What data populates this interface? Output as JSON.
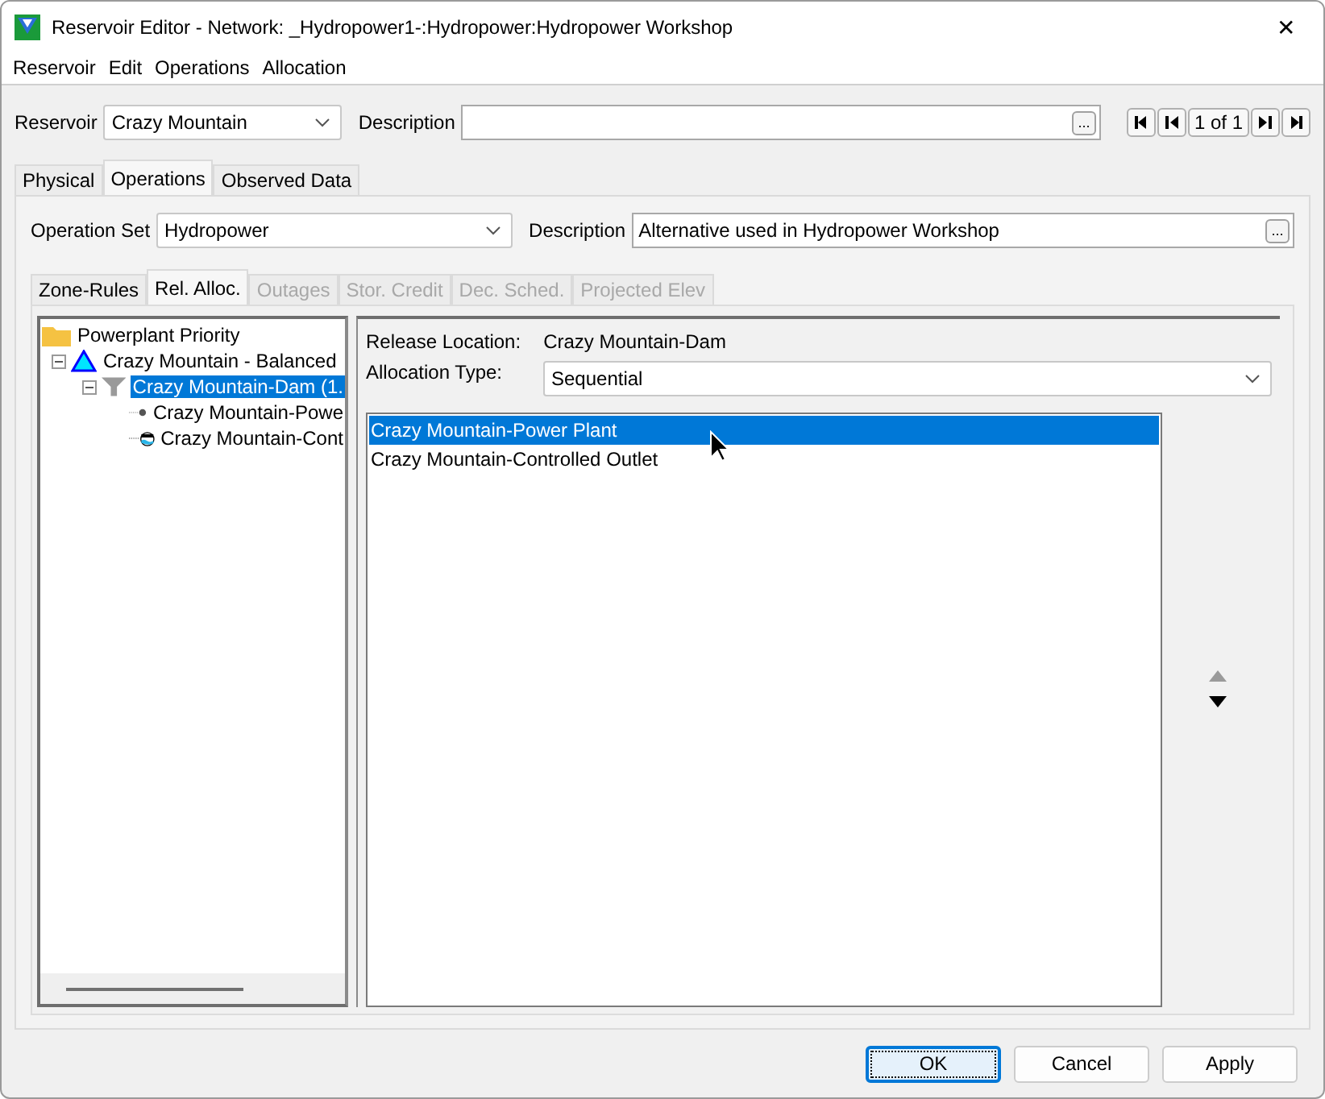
{
  "window": {
    "title": "Reservoir Editor - Network: _Hydropower1-:Hydropower:Hydropower Workshop",
    "close": "✕"
  },
  "menu": [
    "Reservoir",
    "Edit",
    "Operations",
    "Allocation"
  ],
  "reservoir": {
    "label": "Reservoir",
    "value": "Crazy Mountain"
  },
  "description": {
    "label": "Description",
    "browse": "..."
  },
  "record_nav": {
    "position": "1 of 1"
  },
  "tabs": [
    {
      "label": "Physical",
      "selected": false
    },
    {
      "label": "Operations",
      "selected": true
    },
    {
      "label": "Observed Data",
      "selected": false
    }
  ],
  "operation_set": {
    "label": "Operation Set",
    "value": "Hydropower"
  },
  "set_description": {
    "label": "Description",
    "value": "Alternative used in Hydropower Workshop",
    "browse": "..."
  },
  "subtabs": [
    {
      "label": "Zone-Rules",
      "selected": false,
      "disabled": false
    },
    {
      "label": "Rel. Alloc.",
      "selected": true,
      "disabled": false
    },
    {
      "label": "Outages",
      "selected": false,
      "disabled": true
    },
    {
      "label": "Stor. Credit",
      "selected": false,
      "disabled": true
    },
    {
      "label": "Dec. Sched.",
      "selected": false,
      "disabled": true
    },
    {
      "label": "Projected Elev",
      "selected": false,
      "disabled": true
    }
  ],
  "tree": [
    {
      "label": "Powerplant Priority",
      "kind": "folder",
      "selected": false,
      "children": [
        {
          "label": "Crazy Mountain - Balanced",
          "kind": "reservoir",
          "expanded": true,
          "selected": false,
          "children": [
            {
              "label": "Crazy Mountain-Dam (1.",
              "kind": "dam",
              "expanded": true,
              "selected": true,
              "children": [
                {
                  "label": "Crazy Mountain-Powe",
                  "kind": "power-plant",
                  "selected": false
                },
                {
                  "label": "Crazy Mountain-Cont",
                  "kind": "outlet",
                  "selected": false
                }
              ]
            }
          ]
        }
      ]
    }
  ],
  "release": {
    "location_label": "Release Location:",
    "location": "Crazy Mountain-Dam",
    "type_label": "Allocation Type:",
    "type": "Sequential"
  },
  "allocation_list": [
    {
      "label": "Crazy Mountain-Power Plant",
      "selected": true
    },
    {
      "label": "Crazy Mountain-Controlled Outlet",
      "selected": false
    }
  ],
  "move_buttons": [
    {
      "kind": "up",
      "disabled": true
    },
    {
      "kind": "down",
      "disabled": false
    }
  ],
  "buttons": [
    {
      "label": "OK",
      "default": true
    },
    {
      "label": "Cancel",
      "default": false
    },
    {
      "label": "Apply",
      "default": false
    }
  ]
}
